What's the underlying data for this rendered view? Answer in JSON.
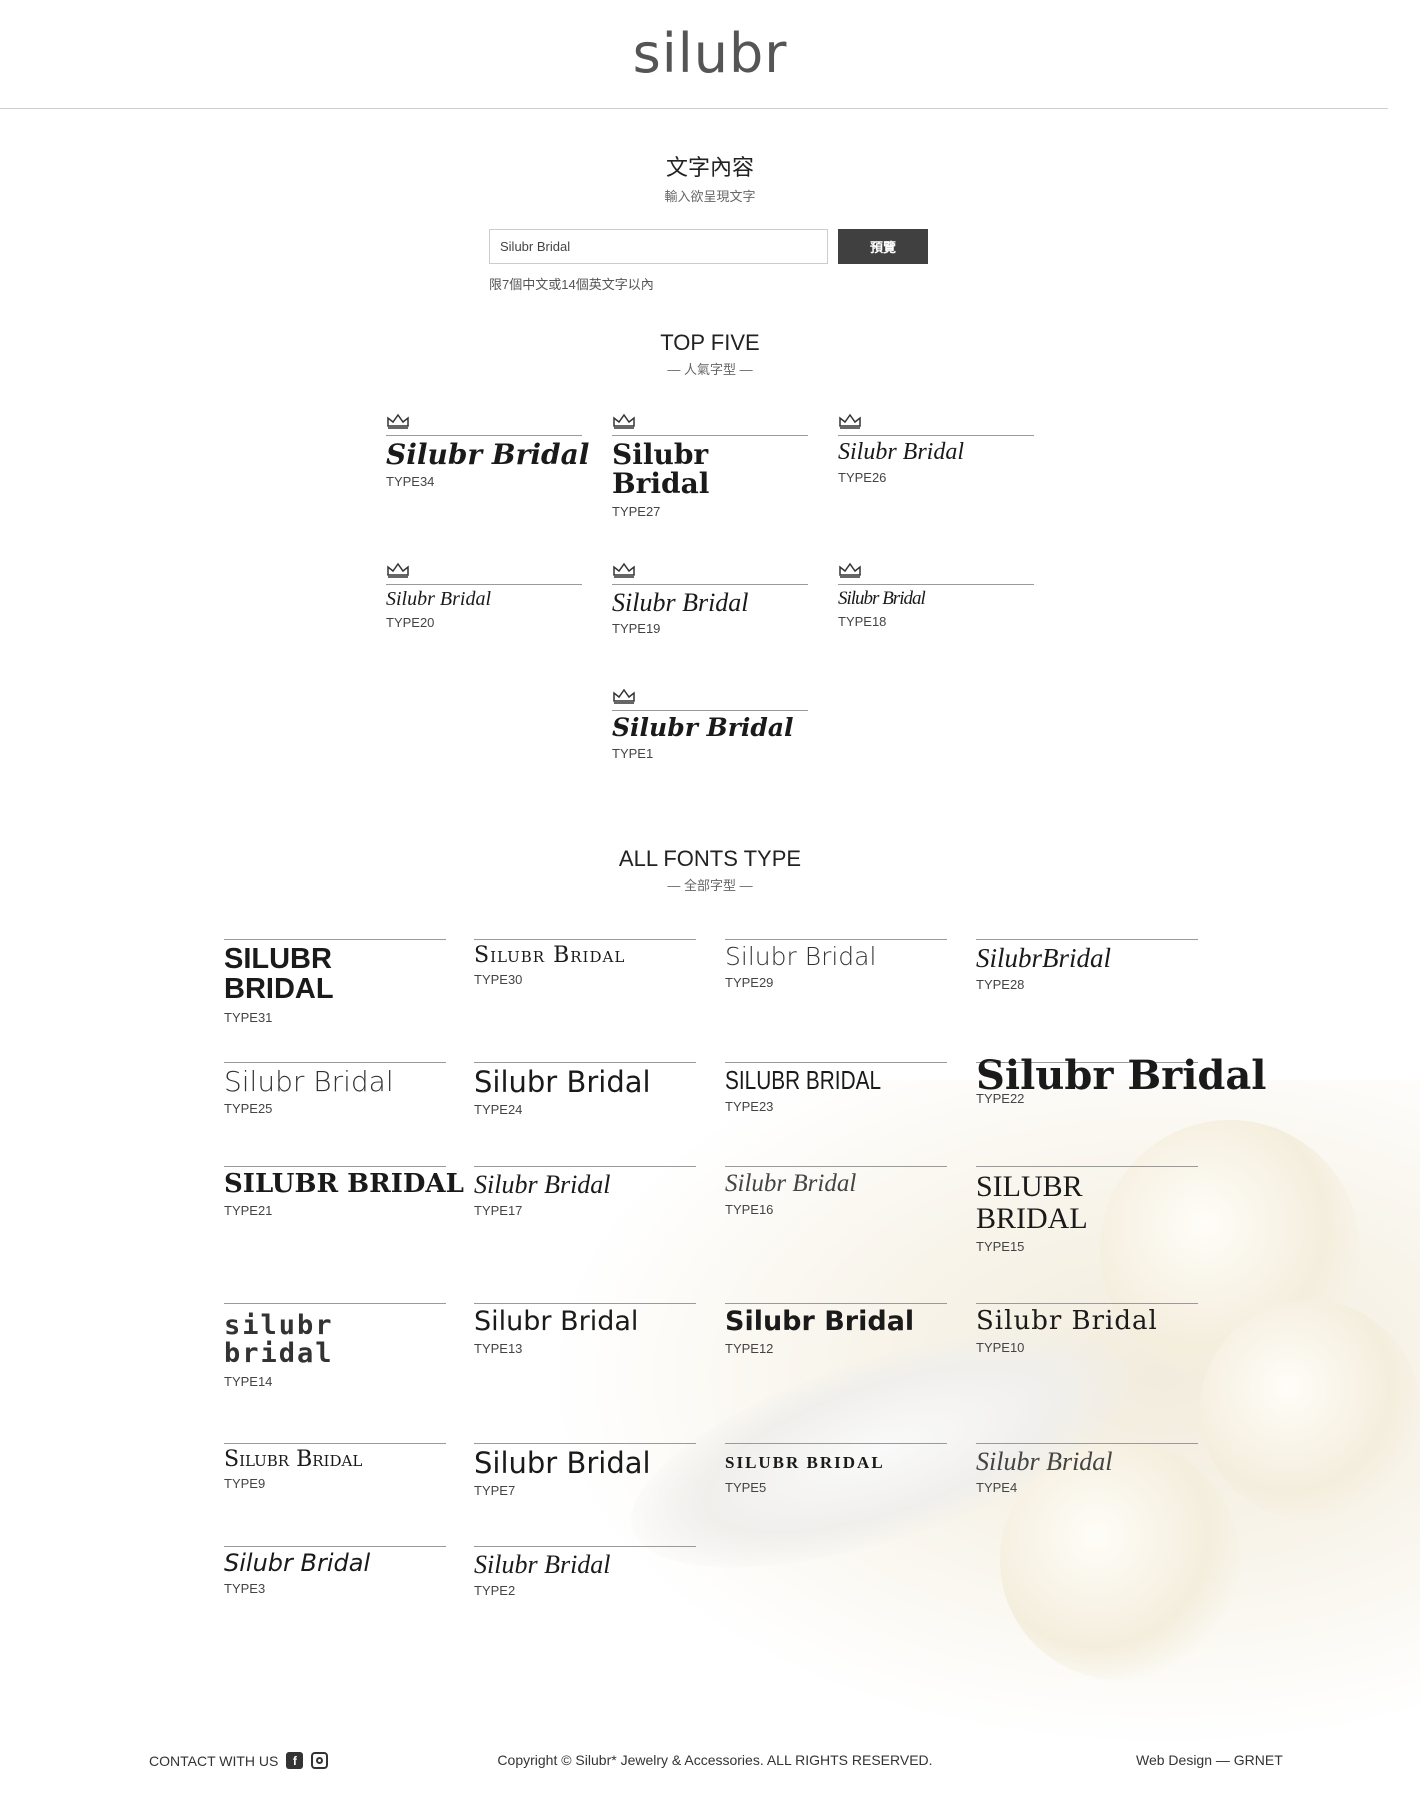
{
  "brand": {
    "logo": "silubr"
  },
  "text_content": {
    "title": "文字內容",
    "subtitle": "輸入欲呈現文字",
    "input_value": "Silubr Bridal",
    "preview_button": "預覽",
    "hint": "限7個中文或14個英文字以內"
  },
  "top_five": {
    "title": "TOP FIVE",
    "subtitle": "— 人氣字型 —",
    "items": [
      {
        "sample": "Silubr Bridal",
        "type": "TYPE34",
        "crown_icon": "crown-icon"
      },
      {
        "sample": "Silubr Bridal",
        "type": "TYPE27",
        "crown_icon": "crown-icon"
      },
      {
        "sample": "Silubr Bridal",
        "type": "TYPE26",
        "crown_icon": "crown-icon"
      },
      {
        "sample": "Silubr Bridal",
        "type": "TYPE20",
        "crown_icon": "crown-icon"
      },
      {
        "sample": "Silubr Bridal",
        "type": "TYPE19",
        "crown_icon": "crown-icon"
      },
      {
        "sample": "Silubr Bridal",
        "type": "TYPE18",
        "crown_icon": "crown-icon"
      },
      {
        "sample": "Silubr Bridal",
        "type": "TYPE1",
        "crown_icon": "crown-icon"
      }
    ]
  },
  "all_fonts": {
    "title": "ALL FONTS TYPE",
    "subtitle": "— 全部字型 —",
    "items": [
      {
        "sample": "SILUBR BRIDAL",
        "type": "TYPE31"
      },
      {
        "sample": "Silubr Bridal",
        "type": "TYPE30"
      },
      {
        "sample": "Silubr Bridal",
        "type": "TYPE29"
      },
      {
        "sample": "SilubrBridal",
        "type": "TYPE28"
      },
      {
        "sample": "Silubr Bridal",
        "type": "TYPE25"
      },
      {
        "sample": "Silubr Bridal",
        "type": "TYPE24"
      },
      {
        "sample": "SILUBR BRIDAL",
        "type": "TYPE23"
      },
      {
        "sample": "Silubr Bridal",
        "type": "TYPE22"
      },
      {
        "sample": "SILUBR BRIDAL",
        "type": "TYPE21"
      },
      {
        "sample": "Silubr Bridal",
        "type": "TYPE17"
      },
      {
        "sample": "Silubr Bridal",
        "type": "TYPE16"
      },
      {
        "sample": "SILUBR BRIDAL",
        "type": "TYPE15"
      },
      {
        "sample": "silubr bridal",
        "type": "TYPE14"
      },
      {
        "sample": "Silubr Bridal",
        "type": "TYPE13"
      },
      {
        "sample": "Silubr Bridal",
        "type": "TYPE12"
      },
      {
        "sample": "Silubr Bridal",
        "type": "TYPE10"
      },
      {
        "sample": "Silubr Bridal",
        "type": "TYPE9"
      },
      {
        "sample": "Silubr Bridal",
        "type": "TYPE7"
      },
      {
        "sample": "SILUBR BRIDAL",
        "type": "TYPE5"
      },
      {
        "sample": "Silubr Bridal",
        "type": "TYPE4"
      },
      {
        "sample": "Silubr Bridal",
        "type": "TYPE3"
      },
      {
        "sample": "Silubr Bridal",
        "type": "TYPE2"
      }
    ]
  },
  "footer": {
    "contact": "CONTACT WITH US",
    "facebook_icon": "facebook-icon",
    "instagram_icon": "instagram-icon",
    "copyright": "Copyright © Silubr* Jewelry & Accessories. ALL RIGHTS RESERVED.",
    "credit": "Web Design — GRNET"
  }
}
